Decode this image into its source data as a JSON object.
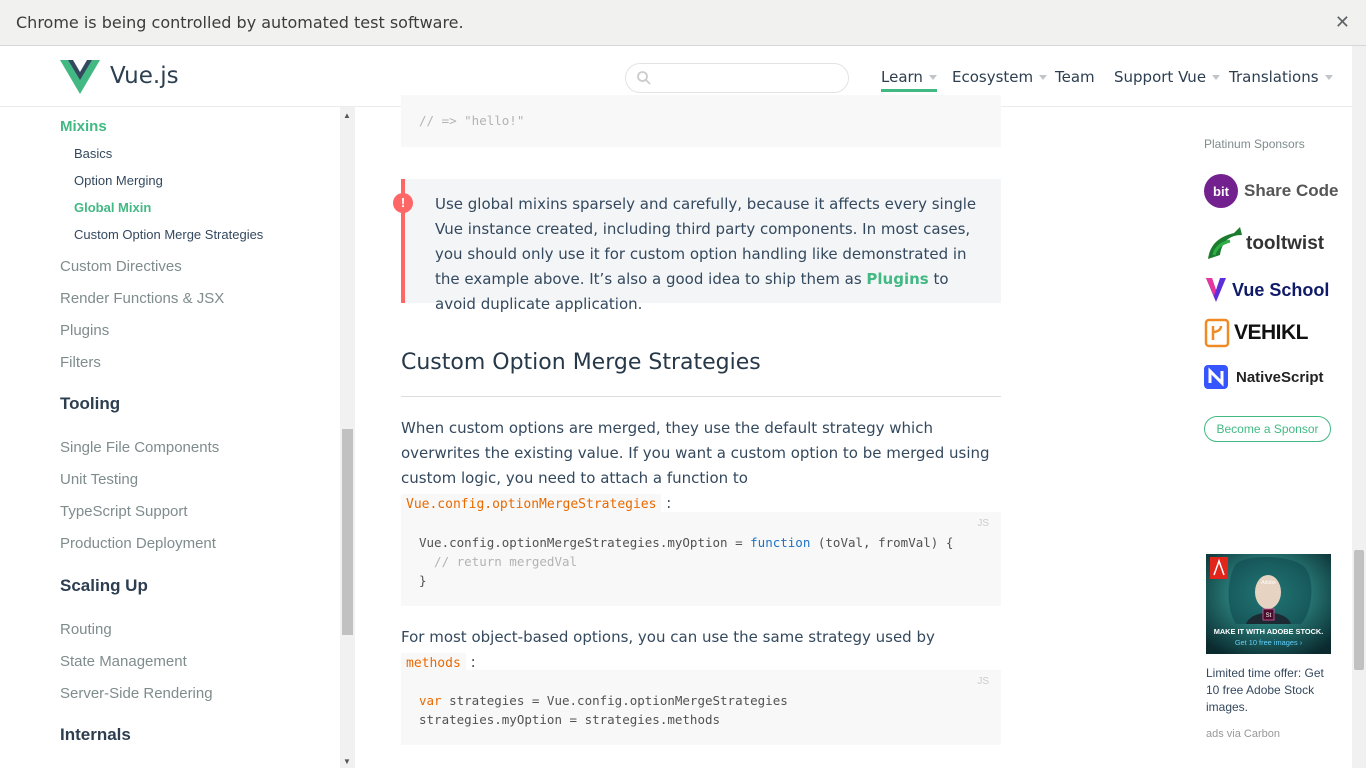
{
  "infobar": {
    "message": "Chrome is being controlled by automated test software.",
    "close": "✕"
  },
  "header": {
    "brand": "Vue.js",
    "search_placeholder": "",
    "nav": [
      {
        "label": "Learn",
        "dropdown": true,
        "active": true
      },
      {
        "label": "Ecosystem",
        "dropdown": true
      },
      {
        "label": "Team",
        "dropdown": false
      },
      {
        "label": "Support Vue",
        "dropdown": true
      },
      {
        "label": "Translations",
        "dropdown": true
      }
    ]
  },
  "sidebar": {
    "mixins": "Mixins",
    "mixins_subs": [
      "Basics",
      "Option Merging",
      "Global Mixin",
      "Custom Option Merge Strategies"
    ],
    "after_mixins": [
      "Custom Directives",
      "Render Functions & JSX",
      "Plugins",
      "Filters"
    ],
    "tooling_heading": "Tooling",
    "tooling": [
      "Single File Components",
      "Unit Testing",
      "TypeScript Support",
      "Production Deployment"
    ],
    "scaling_heading": "Scaling Up",
    "scaling": [
      "Routing",
      "State Management",
      "Server-Side Rendering"
    ],
    "internals_heading": "Internals"
  },
  "content": {
    "code_top_line": "// => \"hello!\"",
    "tip_badge": "!",
    "tip_text_1": "Use global mixins sparsely and carefully, because it affects every single Vue instance created, including third party components. In most cases, you should only use it for custom option handling like demonstrated in the example above. It’s also a good idea to ship them as ",
    "tip_link": "Plugins",
    "tip_text_2": " to avoid duplicate application.",
    "heading": "Custom Option Merge Strategies",
    "para1_a": "When custom options are merged, they use the default strategy which overwrites the existing value. If you want a custom option to be merged using custom logic, you need to attach a function to ",
    "para1_code": "Vue.config.optionMergeStrategies",
    "para1_b": " :",
    "code1_lang": "JS",
    "code1": {
      "l1_a": "Vue.config.optionMergeStrategies.myOption = ",
      "l1_kw": "function",
      "l1_b": " (toVal, fromVal) {",
      "l2": "  // return mergedVal",
      "l3": "}"
    },
    "para2_a": "For most object-based options, you can use the same strategy used by ",
    "para2_code": "methods",
    "para2_b": " :",
    "code2_lang": "JS",
    "code2": {
      "l1_kw": "var",
      "l1_b": " strategies = Vue.config.optionMergeStrategies",
      "l2": "strategies.myOption = strategies.methods"
    }
  },
  "sponsors": {
    "title": "Platinum Sponsors",
    "items": [
      {
        "name": "Share Code",
        "icon": "bit-icon",
        "color": "#555"
      },
      {
        "name": "tooltwist",
        "icon": "tooltwist-icon",
        "color": "#333"
      },
      {
        "name": "Vue School",
        "icon": "vueschool-icon",
        "color": "#0f1a68"
      },
      {
        "name": "VEHIKL",
        "icon": "vehikl-icon",
        "color": "#111"
      },
      {
        "name": "NativeScript",
        "icon": "nativescript-icon",
        "color": "#222"
      }
    ],
    "bit_logo_text": "bit",
    "become": "Become a Sponsor"
  },
  "ad": {
    "brand": "Adobe",
    "headline": "MAKE IT WITH ADOBE STOCK.",
    "sub": "Get 10 free images ›",
    "caption": "Limited time offer: Get 10 free Adobe Stock images.",
    "via": "ads via Carbon"
  },
  "colors": {
    "accent": "#42b983",
    "warning": "#ff6666",
    "text": "#34495e"
  }
}
